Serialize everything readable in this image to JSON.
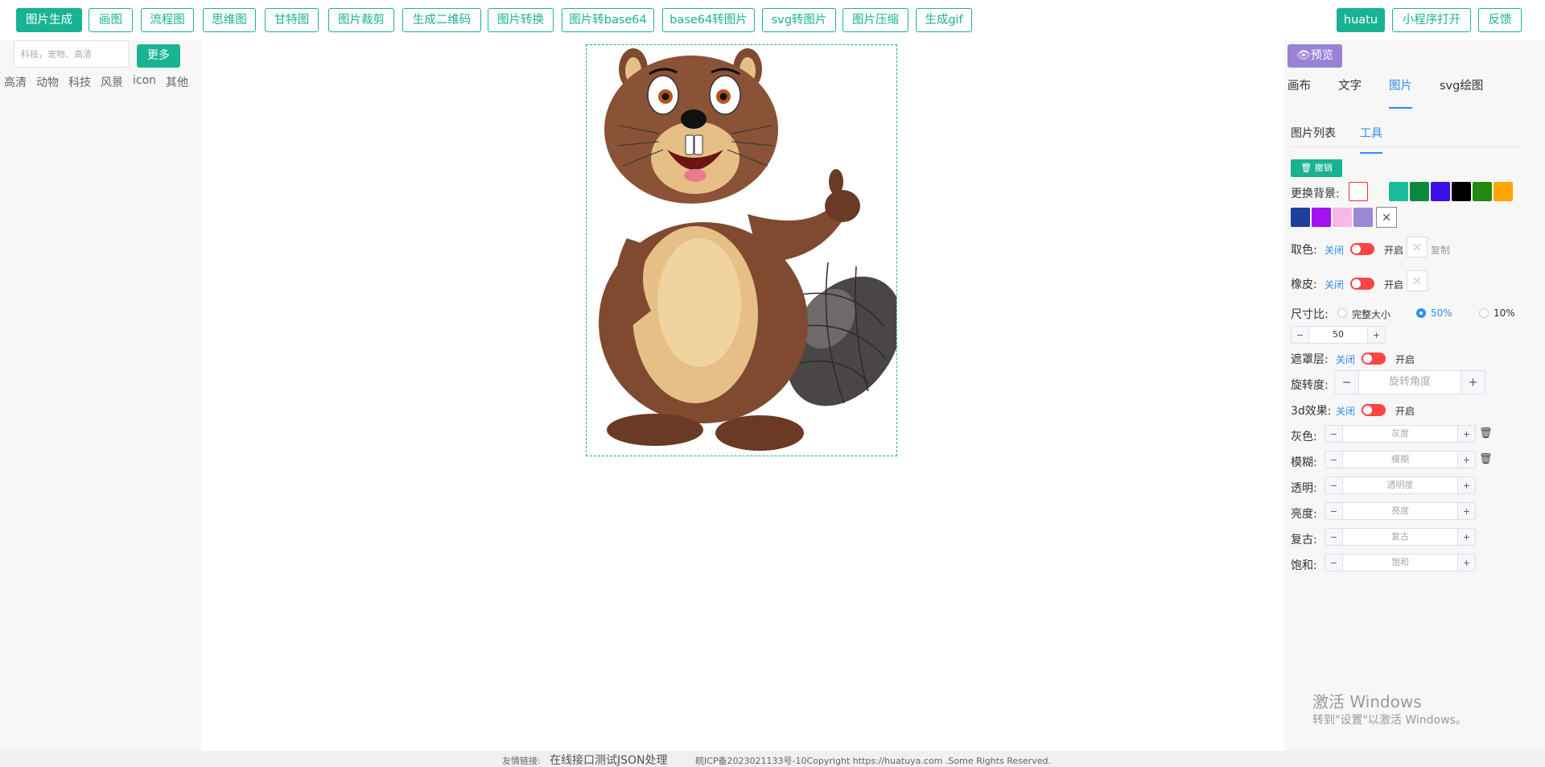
{
  "topnav": {
    "left_buttons": [
      "图片生成",
      "画图",
      "流程图",
      "思维图",
      "甘特图",
      "图片裁剪",
      "生成二维码",
      "图片转换",
      "图片转base64",
      "base64转图片",
      "svg转图片",
      "图片压缩",
      "生成gif"
    ],
    "right_buttons": [
      "huatu",
      "小程序打开",
      "反馈"
    ],
    "active": "图片生成"
  },
  "sidebar": {
    "search_placeholder": "科技，宠物、高清",
    "more_label": "更多",
    "tags": [
      "高清",
      "动物",
      "科技",
      "风景",
      "icon",
      "其他"
    ]
  },
  "panel": {
    "preview_label": "预览",
    "tabs": [
      "画布",
      "文字",
      "图片",
      "svg绘图"
    ],
    "active_tab": "图片",
    "subtabs": [
      "图片列表",
      "工具"
    ],
    "active_subtab": "工具",
    "undo_label": "撤销",
    "bg_label": "更换背景:",
    "bg_colors_row1": [
      "#1abc9c",
      "#0b8a3e",
      "#3b10e8",
      "#000000",
      "#1e8a0e",
      "#ffa500"
    ],
    "bg_colors_row2": [
      "#1e3f9e",
      "#a511f0",
      "#f7b8e8",
      "#9c88d4"
    ],
    "pick_label": "取色:",
    "off_label": "关闭",
    "on_label": "开启",
    "copy_label": "复制",
    "eraser_label": "橡皮:",
    "ratio_label": "尺寸比:",
    "ratio_options": [
      "完整大小",
      "50%",
      "10%"
    ],
    "ratio_selected": "50%",
    "size_value": "50",
    "mask_label": "遮罩层:",
    "rotate_label": "旋转度:",
    "rotate_placeholder": "旋转角度",
    "effect3d_label": "3d效果:",
    "filters": [
      {
        "label": "灰色:",
        "placeholder": "灰度",
        "trash": true
      },
      {
        "label": "模糊:",
        "placeholder": "模糊",
        "trash": true
      },
      {
        "label": "透明:",
        "placeholder": "透明度",
        "trash": false
      },
      {
        "label": "亮度:",
        "placeholder": "亮度",
        "trash": false
      },
      {
        "label": "复古:",
        "placeholder": "复古",
        "trash": false
      },
      {
        "label": "饱和:",
        "placeholder": "饱和",
        "trash": false
      }
    ]
  },
  "watermark": {
    "line1": "激活 Windows",
    "line2": "转到\"设置\"以激活 Windows。"
  },
  "footer": {
    "links_label": "友情链接:",
    "link1": "在线接口测试JSON处理",
    "copyright": "皖ICP备2023021133号-10Copyright https://huatuya.com .Some Rights Reserved."
  }
}
